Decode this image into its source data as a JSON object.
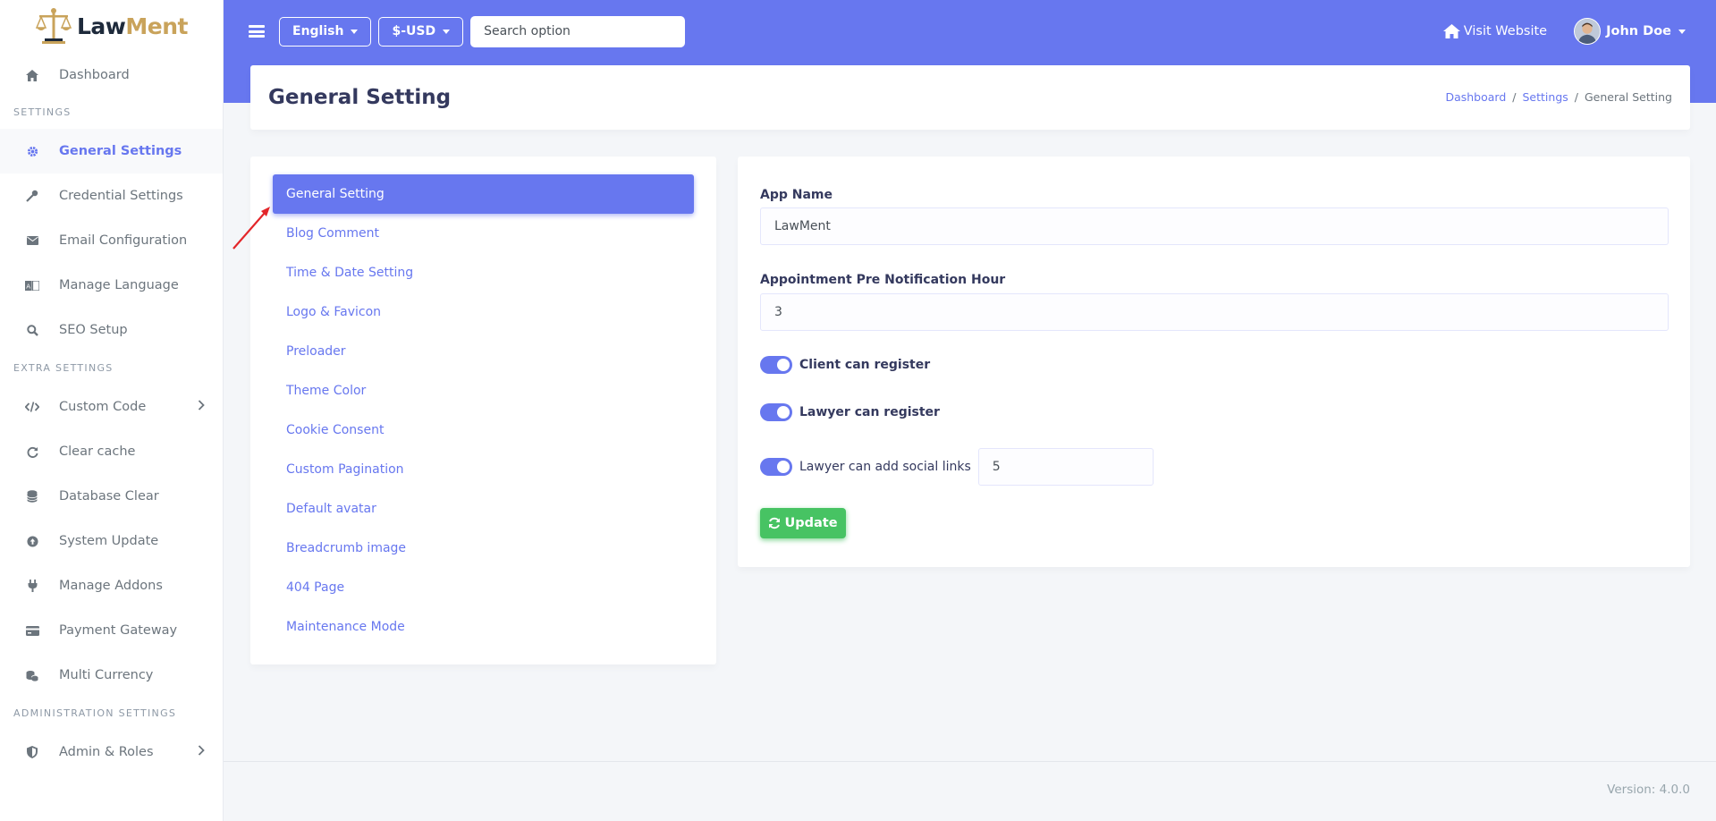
{
  "brand": {
    "name_part1": "Law",
    "name_part2": "Ment"
  },
  "sidebar": {
    "dashboard": "Dashboard",
    "sections": [
      {
        "header": "Settings",
        "items": [
          {
            "label": "General Settings",
            "icon": "gear-icon",
            "active": true
          },
          {
            "label": "Credential Settings",
            "icon": "key-icon"
          },
          {
            "label": "Email Configuration",
            "icon": "envelope-icon"
          },
          {
            "label": "Manage Language",
            "icon": "language-icon"
          },
          {
            "label": "SEO Setup",
            "icon": "search-icon"
          }
        ]
      },
      {
        "header": "Extra Settings",
        "items": [
          {
            "label": "Custom Code",
            "icon": "code-icon",
            "has_children": true
          },
          {
            "label": "Clear cache",
            "icon": "refresh-icon"
          },
          {
            "label": "Database Clear",
            "icon": "database-icon"
          },
          {
            "label": "System Update",
            "icon": "upload-icon"
          },
          {
            "label": "Manage Addons",
            "icon": "plug-icon"
          },
          {
            "label": "Payment Gateway",
            "icon": "credit-card-icon"
          },
          {
            "label": "Multi Currency",
            "icon": "coins-icon"
          }
        ]
      },
      {
        "header": "Administration Settings",
        "items": [
          {
            "label": "Admin & Roles",
            "icon": "shield-icon",
            "has_children": true
          }
        ]
      }
    ]
  },
  "navbar": {
    "language": "English",
    "currency": "$-USD",
    "search_placeholder": "Search option",
    "visit_website": "Visit Website",
    "user_name": "John Doe"
  },
  "header": {
    "title": "General Setting",
    "breadcrumb": [
      "Dashboard",
      "Settings",
      "General Setting"
    ]
  },
  "tabs": [
    "General Setting",
    "Blog Comment",
    "Time & Date Setting",
    "Logo & Favicon",
    "Preloader",
    "Theme Color",
    "Cookie Consent",
    "Custom Pagination",
    "Default avatar",
    "Breadcrumb image",
    "404 Page",
    "Maintenance Mode"
  ],
  "form": {
    "app_name_label": "App Name",
    "app_name_value": "LawMent",
    "notification_label": "Appointment Pre Notification Hour",
    "notification_value": "3",
    "client_register_label": "Client can register",
    "client_register_on": true,
    "lawyer_register_label": "Lawyer can register",
    "lawyer_register_on": true,
    "social_links_label": "Lawyer can add social links",
    "social_links_on": true,
    "social_links_value": "5",
    "update_label": "Update"
  },
  "footer": {
    "version": "Version: 4.0.0"
  },
  "colors": {
    "primary": "#6777ef",
    "success": "#47c363",
    "brand_gold": "#c9a35b"
  }
}
